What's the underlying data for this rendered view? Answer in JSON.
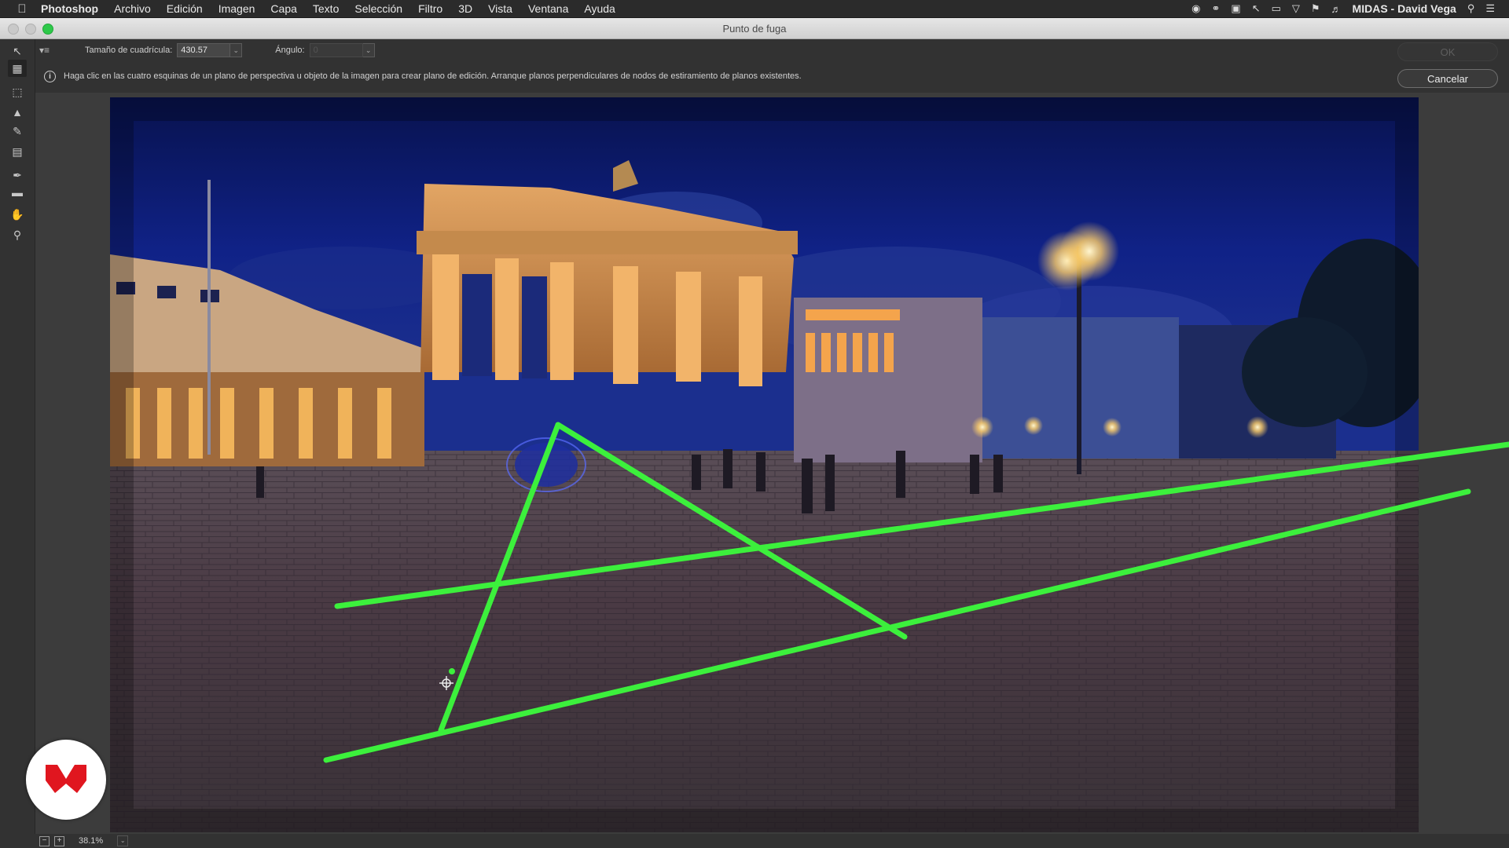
{
  "menubar": {
    "apple": "",
    "app_name": "Photoshop",
    "items": [
      "Archivo",
      "Edición",
      "Imagen",
      "Capa",
      "Texto",
      "Selección",
      "Filtro",
      "3D",
      "Vista",
      "Ventana",
      "Ayuda"
    ],
    "user": "MIDAS - David Vega",
    "status_icons": [
      "record-icon",
      "creative-cloud-icon",
      "display-icon",
      "cursor-icon",
      "airplay-icon",
      "wifi-icon",
      "flag-icon",
      "volume-icon",
      "search-icon",
      "list-icon"
    ]
  },
  "window": {
    "title": "Punto de fuga"
  },
  "options": {
    "grid_label": "Tamaño de cuadrícula:",
    "grid_value": "430.57",
    "angle_label": "Ángulo:",
    "angle_value": "0"
  },
  "info": {
    "text": "Haga clic en las cuatro esquinas de un plano de perspectiva u objeto de la imagen para crear plano de edición. Arranque planos perpendiculares de nodos de estiramiento de planos existentes."
  },
  "buttons": {
    "ok": "OK",
    "cancel": "Cancelar"
  },
  "tools": [
    "edit-plane-tool-icon",
    "create-plane-tool-icon",
    "marquee-tool-icon",
    "stamp-tool-icon",
    "brush-tool-icon",
    "transform-tool-icon",
    "eyedropper-tool-icon",
    "measure-tool-icon",
    "hand-tool-icon",
    "zoom-tool-icon"
  ],
  "zoom": {
    "value": "38.1%"
  },
  "colors": {
    "perspective_line": "#3cf03c",
    "window_bg": "#323232",
    "brand_logo": "#e0161f"
  }
}
